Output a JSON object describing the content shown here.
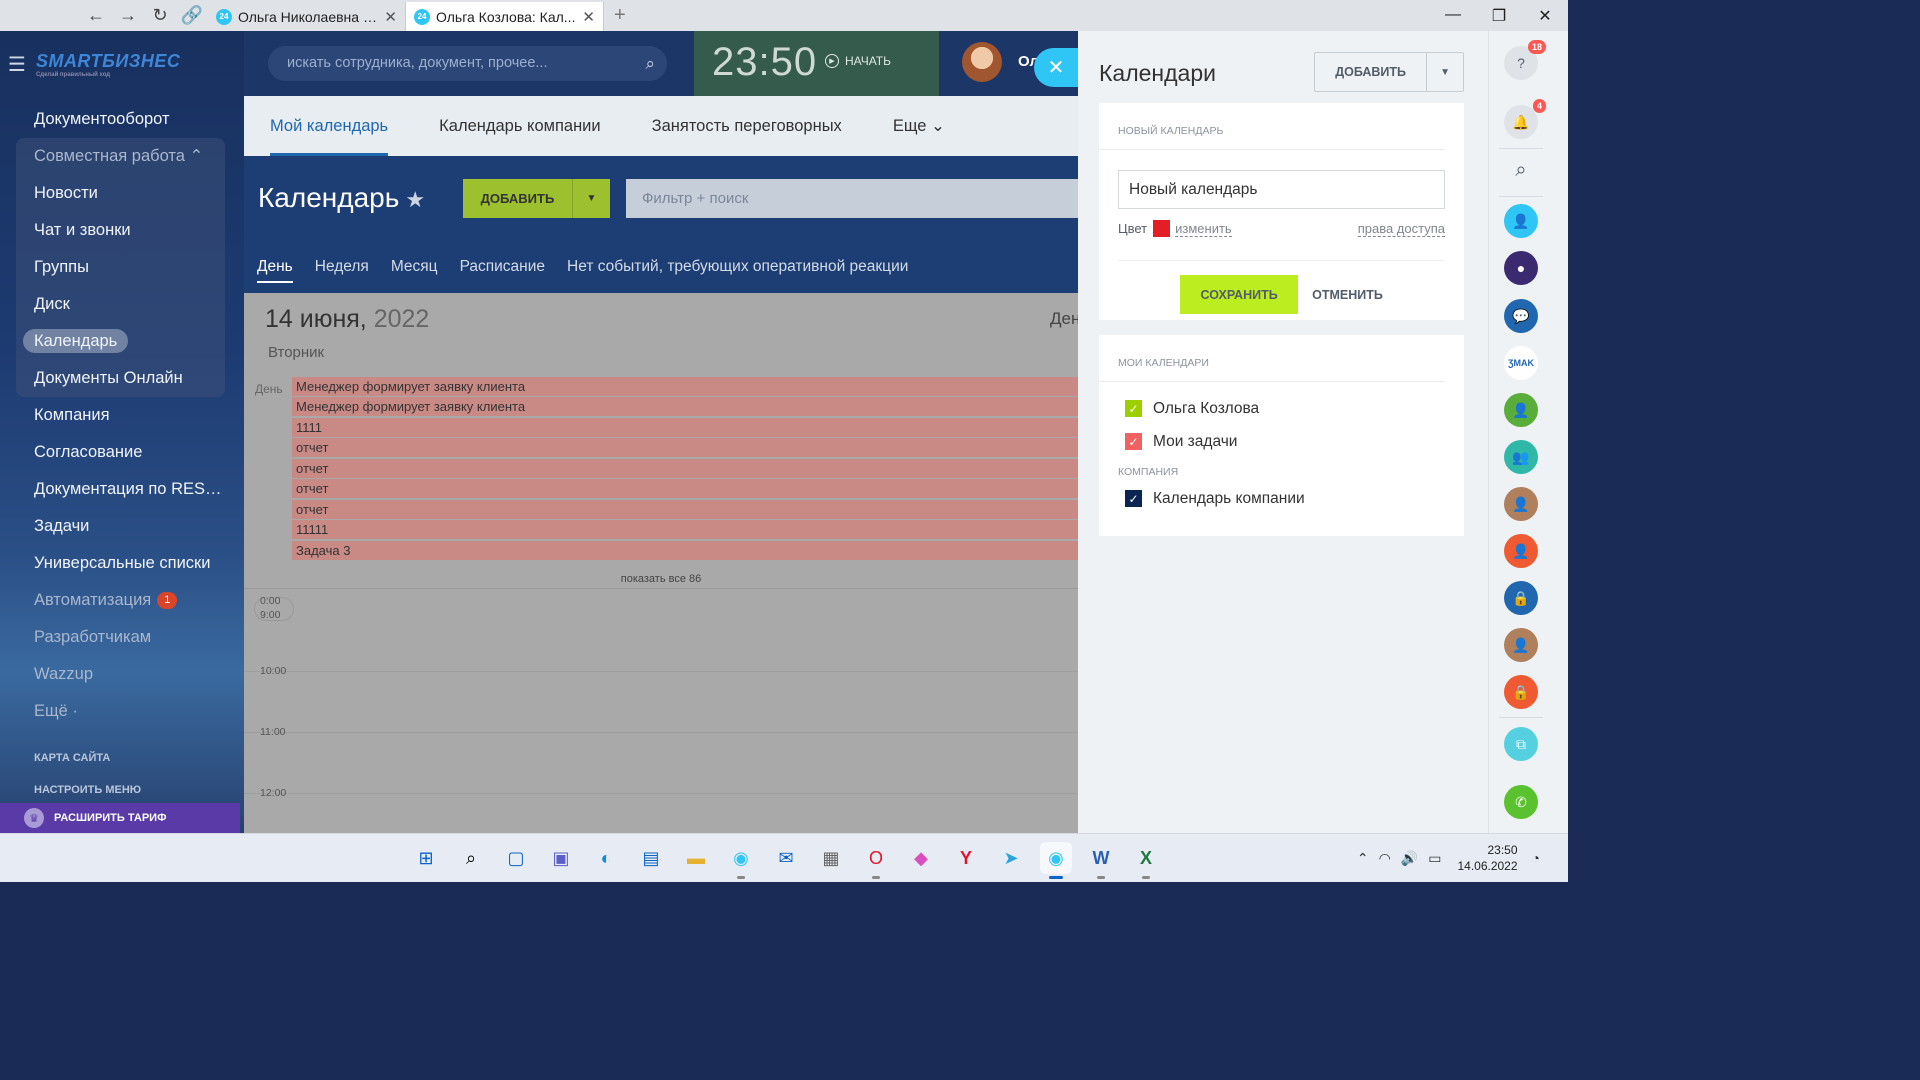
{
  "browser": {
    "tabs": [
      {
        "title": "Ольга Николаевна К...",
        "favicon": "24"
      },
      {
        "title": "Ольга Козлова: Кал...",
        "favicon": "24"
      }
    ],
    "new_tab": "+"
  },
  "sidebar": {
    "logo": "SMARTБИЗНЕС",
    "logo_tag": "Сделай правильный ход",
    "items": [
      {
        "label": "Документооборот"
      },
      {
        "label": "Совместная работа ⌃"
      },
      {
        "label": "Новости"
      },
      {
        "label": "Чат и звонки"
      },
      {
        "label": "Группы"
      },
      {
        "label": "Диск"
      },
      {
        "label": "Календарь"
      },
      {
        "label": "Документы Онлайн"
      },
      {
        "label": "Компания"
      },
      {
        "label": "Согласование"
      },
      {
        "label": "Документация по REST ..."
      },
      {
        "label": "Задачи"
      },
      {
        "label": "Универсальные списки"
      },
      {
        "label": "Автоматизация",
        "badge": "1"
      },
      {
        "label": "Разработчикам"
      },
      {
        "label": "Wazzup"
      },
      {
        "label": "Ещё ·"
      }
    ],
    "site_map": "КАРТА САЙТА",
    "configure_menu": "НАСТРОИТЬ МЕНЮ",
    "expand_tariff": "РАСШИРИТЬ ТАРИФ"
  },
  "header": {
    "search_placeholder": "искать сотрудника, документ, прочее...",
    "clock": "23:50",
    "start_label": "НАЧАТЬ",
    "user_name": "Ол"
  },
  "calendar": {
    "tabs": [
      {
        "label": "Мой календарь"
      },
      {
        "label": "Календарь компании"
      },
      {
        "label": "Занятость переговорных"
      },
      {
        "label": "Еще ⌄"
      }
    ],
    "title": "Календарь",
    "add_label": "ДОБАВИТЬ",
    "filter_placeholder": "Фильтр + поиск",
    "views": [
      {
        "label": "День"
      },
      {
        "label": "Неделя"
      },
      {
        "label": "Месяц"
      },
      {
        "label": "Расписание"
      },
      {
        "label": "Нет событий, требующих оперативной реакции"
      }
    ],
    "date": "14 июня,",
    "year": "2022",
    "weekday": "Вторник",
    "day_right": "Ден",
    "day_label": "День",
    "events": [
      "Менеджер формирует заявку клиента",
      "Менеджер формирует заявку клиента",
      "1111",
      "отчет",
      "отчет",
      "отчет",
      "отчет",
      "11111",
      "Задача 3"
    ],
    "show_all": "показать все 86",
    "times": [
      "0:00",
      "9:00",
      "10:00",
      "11:00",
      "12:00"
    ]
  },
  "slider": {
    "title": "Календари",
    "add_label": "ДОБАВИТЬ",
    "new_calendar_head": "НОВЫЙ КАЛЕНДАРЬ",
    "new_calendar_value": "Новый календарь",
    "color_label": "Цвет",
    "color": "#e31f25",
    "change_label": "изменить",
    "access_label": "права доступа",
    "save_label": "СОХРАНИТЬ",
    "cancel_label": "ОТМЕНИТЬ",
    "my_calendars_head": "МОИ КАЛЕНДАРИ",
    "my_calendars": [
      {
        "label": "Ольга Козлова",
        "color": "#9dcf00",
        "checked": true
      },
      {
        "label": "Мои задачи",
        "color": "#f06161",
        "checked": true
      }
    ],
    "company_head": "КОМПАНИЯ",
    "company_calendars": [
      {
        "label": "Календарь компании",
        "color": "#0b2451",
        "checked": true
      }
    ]
  },
  "rail": {
    "help_badge": "18",
    "notifications_badge": "4"
  },
  "taskbar": {
    "time": "23:50",
    "date": "14.06.2022"
  }
}
